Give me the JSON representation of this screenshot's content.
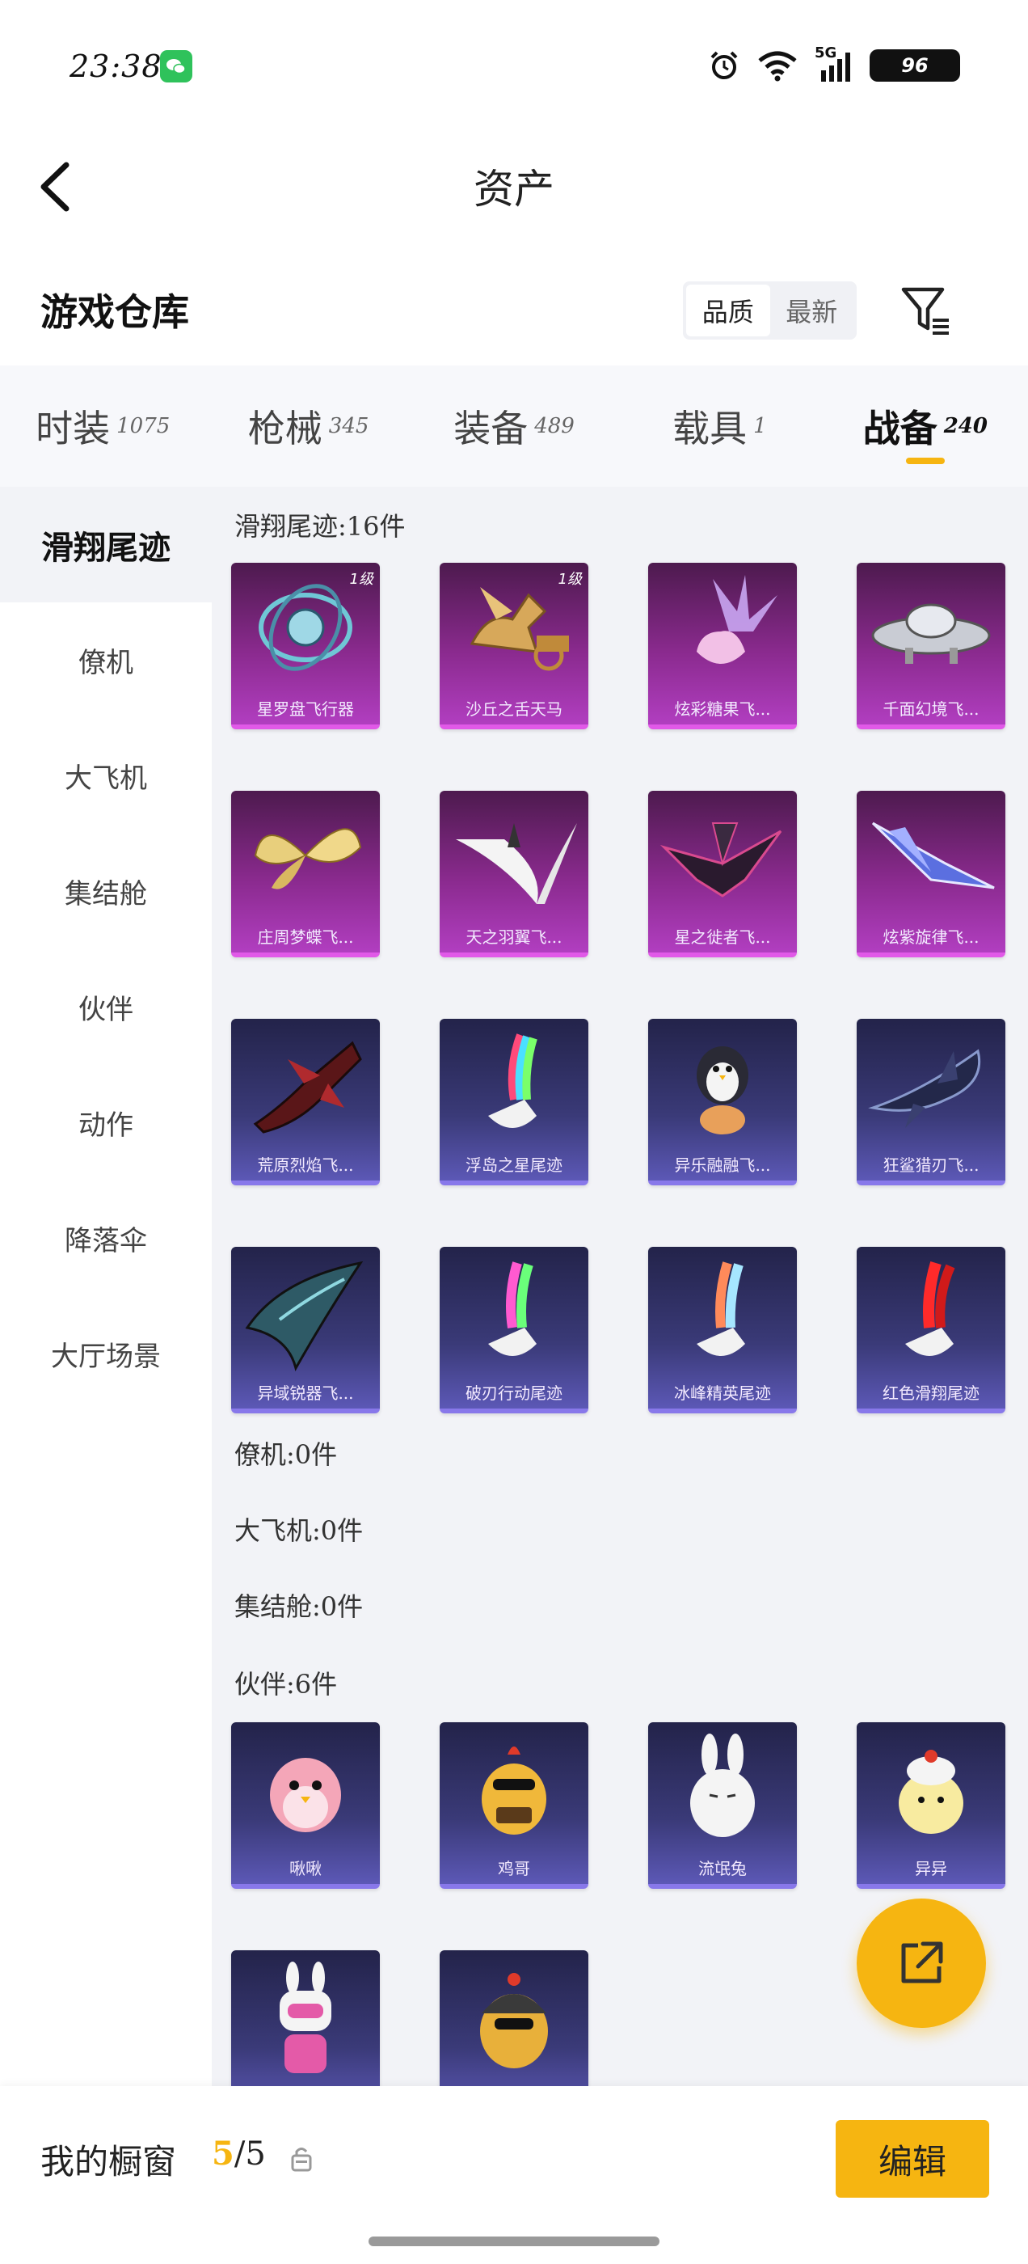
{
  "status_bar": {
    "time": "23:38",
    "network": "5G",
    "battery": "96"
  },
  "header": {
    "title": "资产"
  },
  "warehouse": {
    "title": "游戏仓库",
    "sort_options": [
      {
        "label": "品质",
        "active": true
      },
      {
        "label": "最新",
        "active": false
      }
    ]
  },
  "category_tabs": [
    {
      "label": "时装",
      "count": "1075",
      "active": false
    },
    {
      "label": "枪械",
      "count": "345",
      "active": false
    },
    {
      "label": "装备",
      "count": "489",
      "active": false
    },
    {
      "label": "载具",
      "count": "1",
      "active": false
    },
    {
      "label": "战备",
      "count": "240",
      "active": true
    }
  ],
  "side_nav": [
    {
      "label": "滑翔尾迹",
      "active": true
    },
    {
      "label": "僚机",
      "active": false
    },
    {
      "label": "大飞机",
      "active": false
    },
    {
      "label": "集结舱",
      "active": false
    },
    {
      "label": "伙伴",
      "active": false
    },
    {
      "label": "动作",
      "active": false
    },
    {
      "label": "降落伞",
      "active": false
    },
    {
      "label": "大厅场景",
      "active": false
    }
  ],
  "sections": {
    "trails_title": "滑翔尾迹:16件",
    "wingman_title": "僚机:0件",
    "plane_title": "大飞机:0件",
    "pod_title": "集结舱:0件",
    "partner_title": "伙伴:6件"
  },
  "trail_items": [
    {
      "name": "星罗盘飞行器",
      "rarity": "pink",
      "level": "1级",
      "icon": "astrolabe-icon"
    },
    {
      "name": "沙丘之舌天马",
      "rarity": "pink",
      "level": "1级",
      "icon": "pegasus-chariot-icon"
    },
    {
      "name": "炫彩糖果飞...",
      "rarity": "pink",
      "level": "",
      "icon": "crystal-candy-icon"
    },
    {
      "name": "千面幻境飞...",
      "rarity": "pink",
      "level": "",
      "icon": "ufo-icon"
    },
    {
      "name": "庄周梦蝶飞...",
      "rarity": "pink",
      "level": "",
      "icon": "butterfly-icon"
    },
    {
      "name": "天之羽翼飞...",
      "rarity": "pink",
      "level": "",
      "icon": "feather-wing-icon"
    },
    {
      "name": "星之徙者飞...",
      "rarity": "pink",
      "level": "",
      "icon": "dark-wing-icon"
    },
    {
      "name": "炫紫旋律飞...",
      "rarity": "pink",
      "level": "",
      "icon": "blue-glider-icon"
    },
    {
      "name": "荒原烈焰飞...",
      "rarity": "purple",
      "level": "",
      "icon": "red-jet-icon"
    },
    {
      "name": "浮岛之星尾迹",
      "rarity": "purple",
      "level": "",
      "icon": "rainbow-trail-icon"
    },
    {
      "name": "异乐融融飞...",
      "rarity": "purple",
      "level": "",
      "icon": "penguin-icon"
    },
    {
      "name": "狂鲨猎刃飞...",
      "rarity": "purple",
      "level": "",
      "icon": "shark-glider-icon"
    },
    {
      "name": "异域锐器飞...",
      "rarity": "purple",
      "level": "",
      "icon": "teal-wing-icon"
    },
    {
      "name": "破刃行动尾迹",
      "rarity": "purple",
      "level": "",
      "icon": "green-pink-trail-icon"
    },
    {
      "name": "冰峰精英尾迹",
      "rarity": "purple",
      "level": "",
      "icon": "ice-trail-icon"
    },
    {
      "name": "红色滑翔尾迹",
      "rarity": "purple",
      "level": "",
      "icon": "red-trail-icon"
    }
  ],
  "partner_items": [
    {
      "name": "啾啾",
      "icon": "pink-bird-icon"
    },
    {
      "name": "鸡哥",
      "icon": "chicken-icon"
    },
    {
      "name": "流氓兔",
      "icon": "bunny-icon"
    },
    {
      "name": "异异",
      "icon": "chick-icon"
    },
    {
      "name": "",
      "icon": "pink-robot-icon"
    },
    {
      "name": "",
      "icon": "helmet-chicken-icon"
    }
  ],
  "bottom_bar": {
    "showcase_label": "我的橱窗",
    "showcase_current": "5",
    "showcase_total": "/5",
    "edit_label": "编辑"
  },
  "colors": {
    "accent": "#f6b511",
    "legendary": "#b13ec0",
    "epic": "#5c58b6"
  }
}
